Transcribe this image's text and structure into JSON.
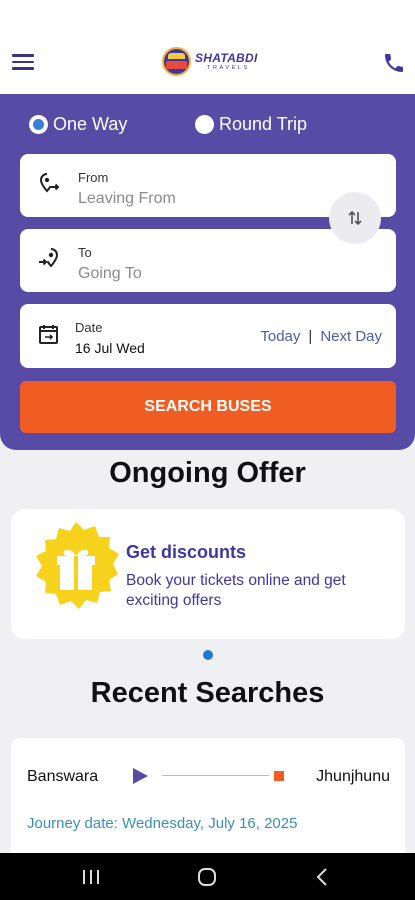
{
  "header": {
    "brand_name": "SHATABDI",
    "brand_sub": "TRAVELS",
    "menu_icon": "hamburger-menu-icon",
    "phone_icon": "phone-icon"
  },
  "search": {
    "trip_types": [
      {
        "label": "One Way",
        "selected": true
      },
      {
        "label": "Round Trip",
        "selected": false
      }
    ],
    "from": {
      "label": "From",
      "placeholder": "Leaving From"
    },
    "to": {
      "label": "To",
      "placeholder": "Going To"
    },
    "date": {
      "label": "Date",
      "value": "16 Jul Wed",
      "today_label": "Today",
      "separator": "|",
      "next_day_label": "Next Day"
    },
    "search_button": "SEARCH BUSES"
  },
  "offers": {
    "title": "Ongoing Offer",
    "items": [
      {
        "heading": "Get discounts",
        "description": "Book your tickets online and get exciting offers"
      }
    ]
  },
  "recent": {
    "title": "Recent Searches",
    "items": [
      {
        "from": "Banswara",
        "to": "Jhunjhunu",
        "journey_date": "Journey date: Wednesday, July 16, 2025"
      }
    ]
  },
  "colors": {
    "primary": "#574ba6",
    "accent": "#f05d23",
    "brand_text": "#3f37a0",
    "badge": "#f6d21c"
  }
}
